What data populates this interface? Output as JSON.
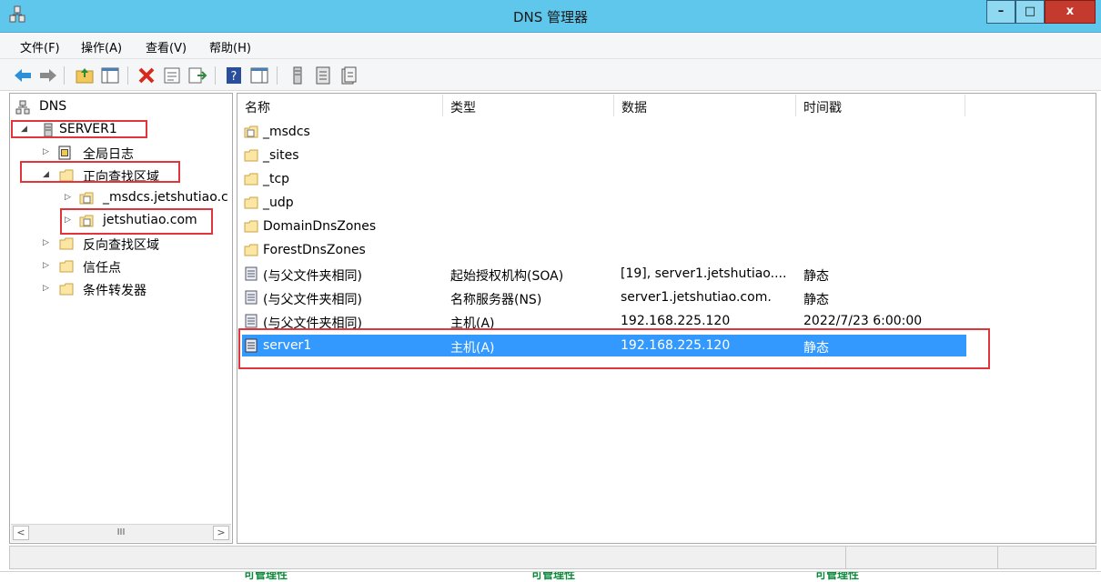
{
  "window": {
    "title": "DNS 管理器",
    "minimize": "–",
    "maximize": "□",
    "close": "x"
  },
  "menu": {
    "file": "文件(F)",
    "action": "操作(A)",
    "view": "查看(V)",
    "help": "帮助(H)"
  },
  "toolbar": {
    "icons": [
      "back-icon",
      "forward-icon",
      "up-folder-icon",
      "show-hide-tree-icon",
      "delete-icon",
      "properties-icon",
      "export-icon",
      "help-icon",
      "show-hide-action-icon",
      "server-icon",
      "zone-list-icon",
      "records-icon"
    ]
  },
  "tree": {
    "root": "DNS",
    "server": "SERVER1",
    "global_logs": "全局日志",
    "forward_zones": "正向查找区域",
    "msdcs_zone": "_msdcs.jetshutiao.c",
    "jetshutiao_zone": "jetshutiao.com",
    "reverse_zones": "反向查找区域",
    "trust_points": "信任点",
    "conditional_forwarders": "条件转发器",
    "scroll_glyph": "III",
    "scroll_left": "<",
    "scroll_right": ">"
  },
  "list": {
    "columns": {
      "name": "名称",
      "type": "类型",
      "data": "数据",
      "timestamp": "时间戳"
    },
    "rows": [
      {
        "name": "_msdcs",
        "type": "",
        "data": "",
        "timestamp": "",
        "icon": "zone-folder-icon"
      },
      {
        "name": "_sites",
        "type": "",
        "data": "",
        "timestamp": "",
        "icon": "folder-icon"
      },
      {
        "name": "_tcp",
        "type": "",
        "data": "",
        "timestamp": "",
        "icon": "folder-icon"
      },
      {
        "name": "_udp",
        "type": "",
        "data": "",
        "timestamp": "",
        "icon": "folder-icon"
      },
      {
        "name": "DomainDnsZones",
        "type": "",
        "data": "",
        "timestamp": "",
        "icon": "folder-icon"
      },
      {
        "name": "ForestDnsZones",
        "type": "",
        "data": "",
        "timestamp": "",
        "icon": "folder-icon"
      },
      {
        "name": "(与父文件夹相同)",
        "type": "起始授权机构(SOA)",
        "data": "[19], server1.jetshutiao....",
        "timestamp": "静态",
        "icon": "record-icon"
      },
      {
        "name": "(与父文件夹相同)",
        "type": "名称服务器(NS)",
        "data": "server1.jetshutiao.com.",
        "timestamp": "静态",
        "icon": "record-icon"
      },
      {
        "name": "(与父文件夹相同)",
        "type": "主机(A)",
        "data": "192.168.225.120",
        "timestamp": "2022/7/23 6:00:00",
        "icon": "record-icon"
      },
      {
        "name": "server1",
        "type": "主机(A)",
        "data": "192.168.225.120",
        "timestamp": "静态",
        "icon": "record-icon",
        "selected": true
      }
    ]
  },
  "bottom_strip": {
    "fragment": "可管理性"
  },
  "colors": {
    "titlebar": "#5fc7ec",
    "selection": "#3399ff",
    "annotation": "#e0353b"
  }
}
